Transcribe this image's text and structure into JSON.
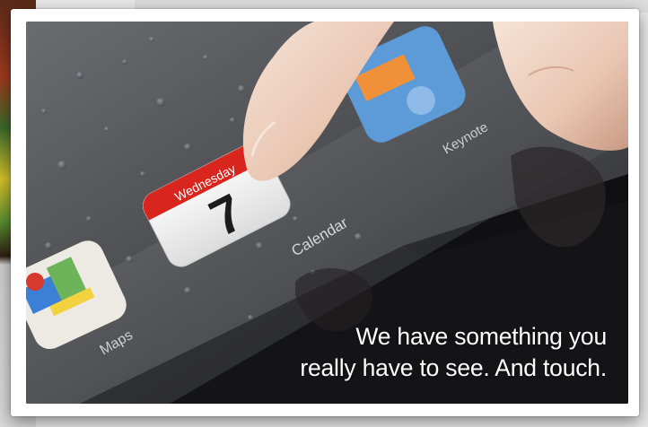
{
  "photo": {
    "tagline_line1": "We have something you",
    "tagline_line2": "really have to see. And touch.",
    "app_labels": {
      "calendar": "Calendar",
      "keynote": "Keynote",
      "maps": "Maps"
    },
    "calendar_icon": {
      "weekday": "Wednesday",
      "day": "7"
    }
  },
  "colors": {
    "calendar_banner": "#d8261f",
    "screen_dark": "#151517",
    "tagline_text": "#ffffff"
  },
  "icons": [
    "calendar-app-icon",
    "keynote-app-icon",
    "maps-app-icon",
    "finger"
  ]
}
